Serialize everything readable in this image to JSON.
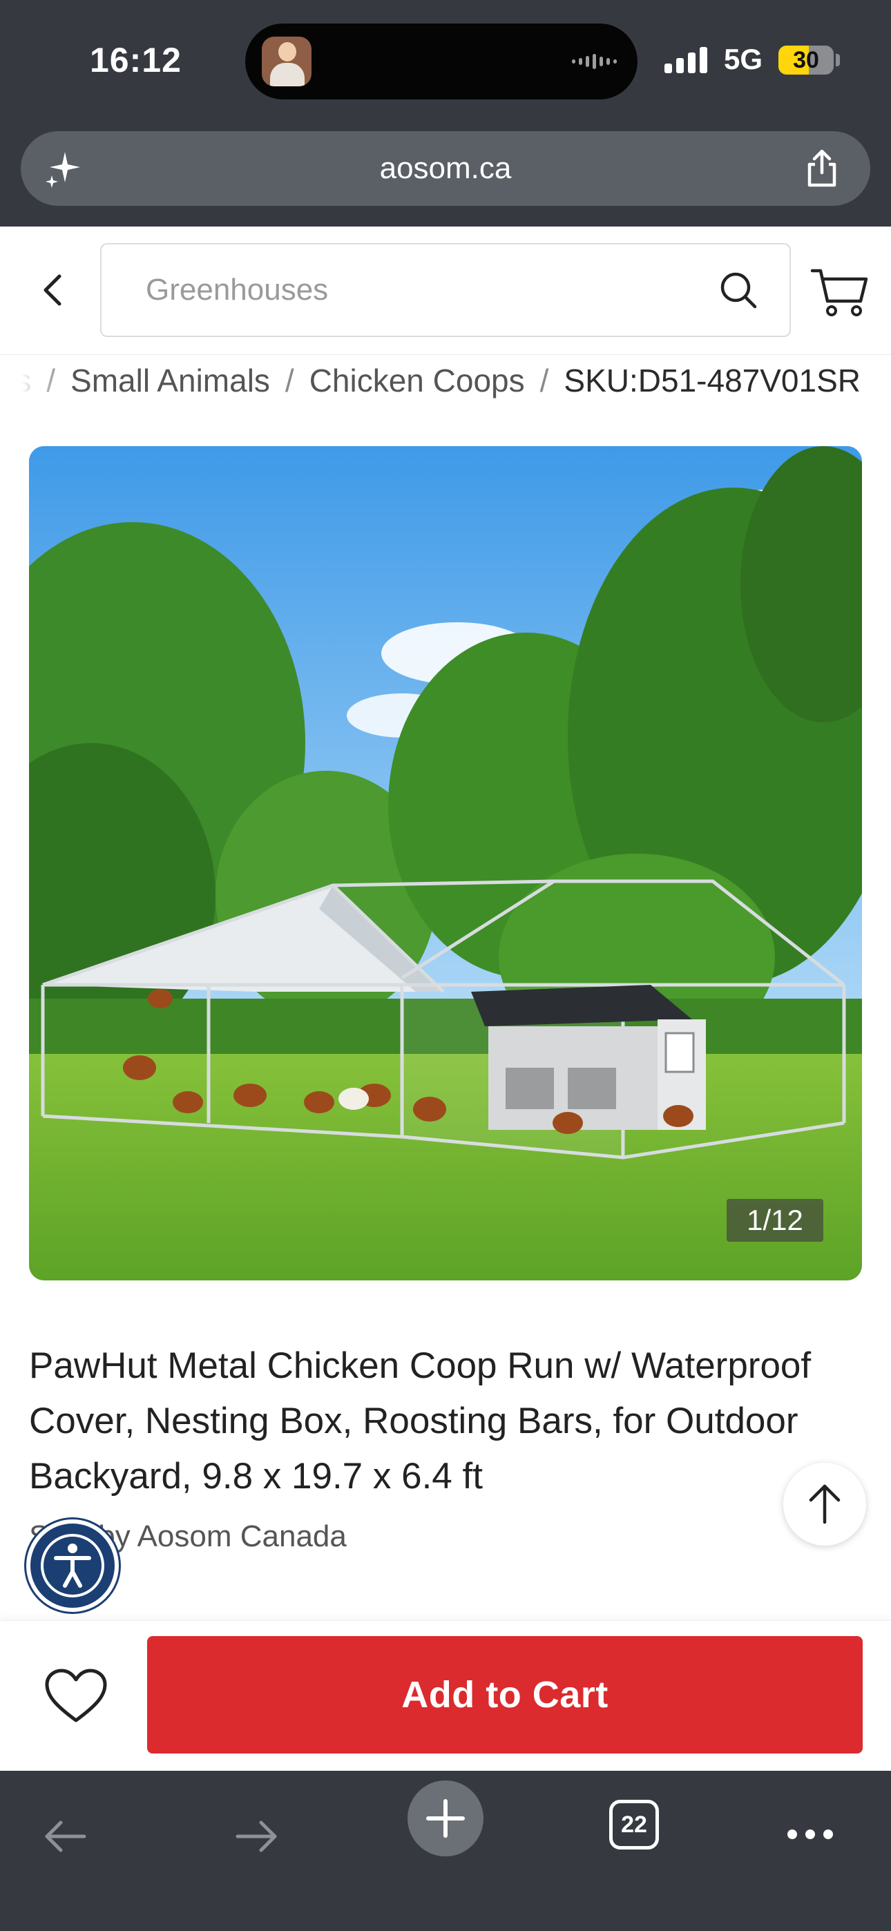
{
  "status_bar": {
    "time": "16:12",
    "network": "5G",
    "battery_level": "30",
    "battery_fraction": 0.3
  },
  "browser": {
    "url": "aosom.ca",
    "tabs_count": "22"
  },
  "header": {
    "search_placeholder": "Greenhouses",
    "icons": [
      "chevron-left-icon",
      "search-icon",
      "cart-icon"
    ]
  },
  "breadcrumb": {
    "items": [
      "s",
      "Small Animals",
      "Chicken Coops",
      "SKU:D51-487V01SR"
    ],
    "separator": "/"
  },
  "product": {
    "image_counter": "1/12",
    "title": "PawHut Metal Chicken Coop Run w/ Waterproof Cover, Nesting Box, Roosting Bars, for Outdoor Backyard, 9.8 x 19.7 x 6.4 ft",
    "seller_line": "Sold by Aosom Canada"
  },
  "actions": {
    "add_to_cart": "Add to Cart"
  },
  "colors": {
    "accent_red": "#db2b2e",
    "chrome_dark": "#363a40",
    "battery_yellow": "#ffd60a",
    "accessibility_blue": "#1b3f72"
  }
}
